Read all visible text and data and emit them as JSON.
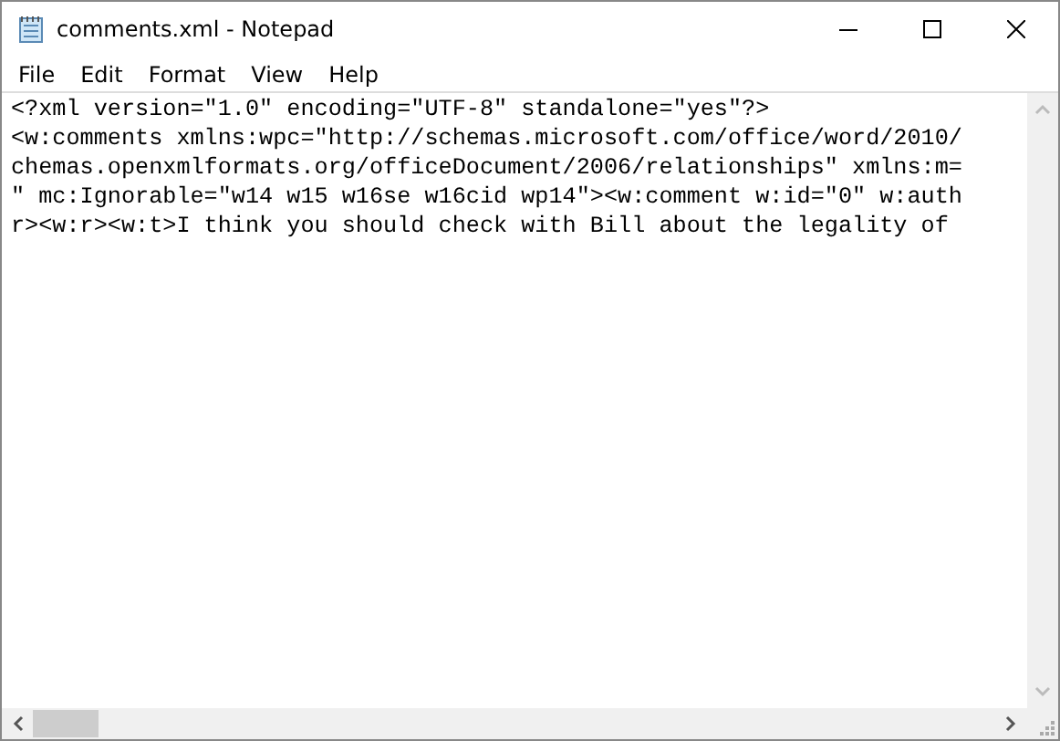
{
  "window": {
    "title": "comments.xml - Notepad"
  },
  "menu": [
    "File",
    "Edit",
    "Format",
    "View",
    "Help"
  ],
  "editor": {
    "lines": [
      "<?xml version=\"1.0\" encoding=\"UTF-8\" standalone=\"yes\"?>",
      "<w:comments xmlns:wpc=\"http://schemas.microsoft.com/office/word/2010/",
      "chemas.openxmlformats.org/officeDocument/2006/relationships\" xmlns:m=",
      "\" mc:Ignorable=\"w14 w15 w16se w16cid wp14\"><w:comment w:id=\"0\" w:auth",
      "r><w:r><w:t>I think you should check with Bill about the legality of"
    ]
  }
}
